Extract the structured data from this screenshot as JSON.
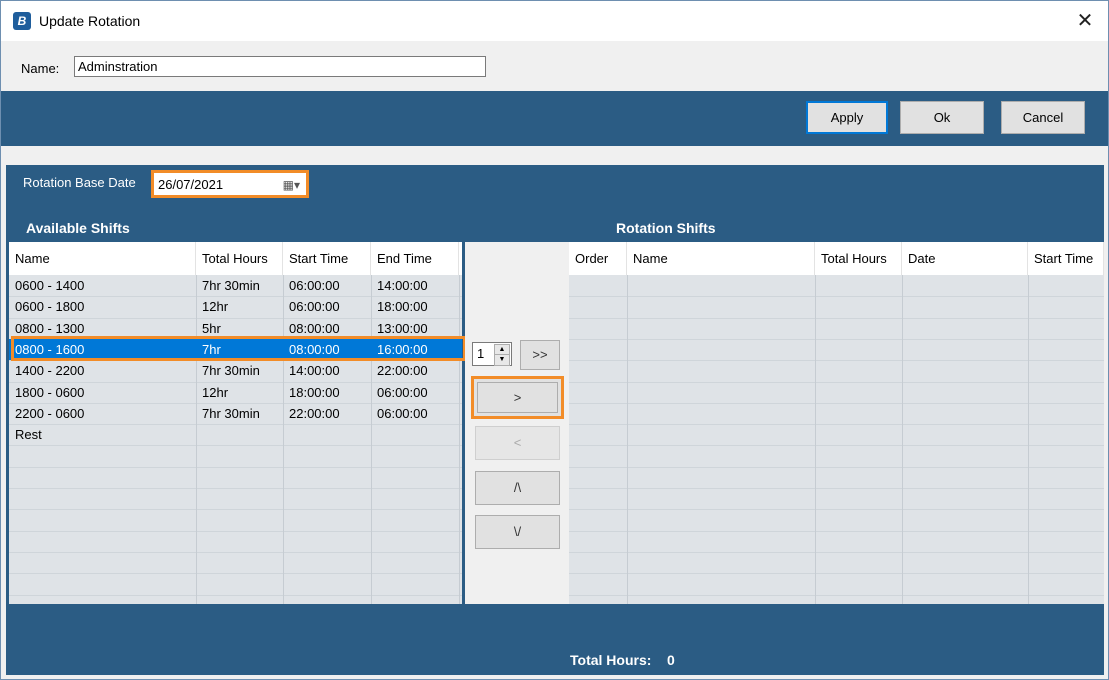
{
  "window": {
    "title": "Update Rotation",
    "close_glyph": "✕",
    "app_icon_glyph": "B"
  },
  "name_field": {
    "label": "Name:",
    "value": "Adminstration"
  },
  "toolbar": {
    "apply_label": "Apply",
    "ok_label": "Ok",
    "cancel_label": "Cancel"
  },
  "base_date": {
    "label": "Rotation Base Date",
    "value": "26/07/2021",
    "icon": "calendar-dropdown-icon"
  },
  "available": {
    "title": "Available Shifts",
    "columns": [
      "Name",
      "Total Hours",
      "Start Time",
      "End Time"
    ],
    "rows": [
      [
        "0600 - 1400",
        "7hr 30min",
        "06:00:00",
        "14:00:00"
      ],
      [
        "0600 - 1800",
        "12hr",
        "06:00:00",
        "18:00:00"
      ],
      [
        "0800 - 1300",
        "5hr",
        "08:00:00",
        "13:00:00"
      ],
      [
        "0800 - 1600",
        "7hr",
        "08:00:00",
        "16:00:00"
      ],
      [
        "1400 - 2200",
        "7hr 30min",
        "14:00:00",
        "22:00:00"
      ],
      [
        "1800 - 0600",
        "12hr",
        "18:00:00",
        "06:00:00"
      ],
      [
        "2200 - 0600",
        "7hr 30min",
        "22:00:00",
        "06:00:00"
      ],
      [
        "Rest",
        "",
        "",
        ""
      ]
    ],
    "selected_row": 3
  },
  "controls": {
    "spinner_value": "1",
    "add_all": ">>",
    "add": ">",
    "remove": "<",
    "up": "/\\",
    "down": "\\/"
  },
  "rotation": {
    "title": "Rotation Shifts",
    "columns": [
      "Order",
      "Name",
      "Total Hours",
      "Date",
      "Start Time"
    ]
  },
  "footer": {
    "total_label": "Total Hours:",
    "total_value": "0"
  },
  "colors": {
    "panel": "#2b5c84",
    "highlight": "#f28c28",
    "selection": "#0078d7"
  }
}
